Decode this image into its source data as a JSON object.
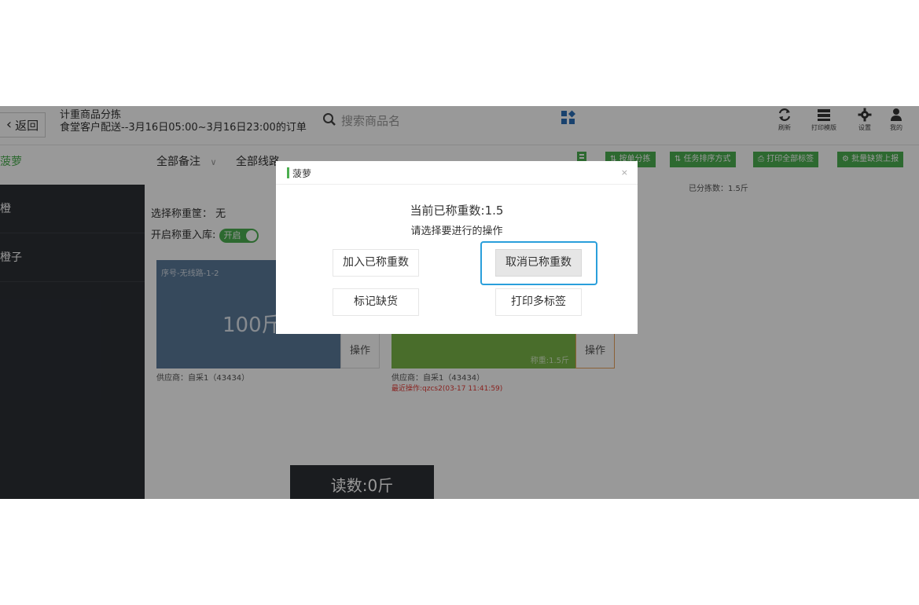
{
  "header": {
    "back_label": "返回",
    "title_line1": "计重商品分拣",
    "title_line2": "食堂客户配送--3月16日05:00~3月16日23:00的订单",
    "search_placeholder": "搜索商品名",
    "tools": [
      {
        "label": "刷新",
        "icon": "refresh-icon"
      },
      {
        "label": "打印模版",
        "icon": "printer-template-icon"
      },
      {
        "label": "设置",
        "icon": "gear-icon"
      },
      {
        "label": "我的",
        "icon": "user-icon"
      }
    ]
  },
  "sidebar": {
    "current": "菠萝",
    "items": [
      "橙",
      "橙子"
    ]
  },
  "filters": {
    "notes": "全部备注",
    "routes": "全部线路"
  },
  "actions": [
    "按单分拣",
    "任务排序方式",
    "打印全部标签",
    "批量缺货上报"
  ],
  "sorted_count": "已分拣数：1.5斤",
  "info": {
    "basket_label": "选择称重筐：",
    "basket_value": "无",
    "storage_label": "开启称重入库:",
    "storage_toggle": "开启"
  },
  "cards": [
    {
      "seq": "序号-无线路-1-2",
      "weight": "100斤",
      "op": "操作",
      "supplier": "供应商：自采1（43434）"
    },
    {
      "weighed": "称重:1.5斤",
      "op": "操作",
      "supplier": "供应商：自采1（43434）",
      "last_op": "最近操作:qzcs2(03-17 11:41:59)"
    }
  ],
  "reading": "读数:0斤",
  "modal": {
    "title": "菠萝",
    "close": "×",
    "current_weight": "当前已称重数:1.5",
    "prompt": "请选择要进行的操作",
    "buttons": {
      "add": "加入已称重数",
      "cancel": "取消已称重数",
      "mark_out": "标记缺货",
      "print_multi": "打印多标签"
    }
  },
  "colors": {
    "brand_green": "#4caf50",
    "focus_blue": "#2a9fdb",
    "sidebar_bg": "#2c2f35"
  }
}
